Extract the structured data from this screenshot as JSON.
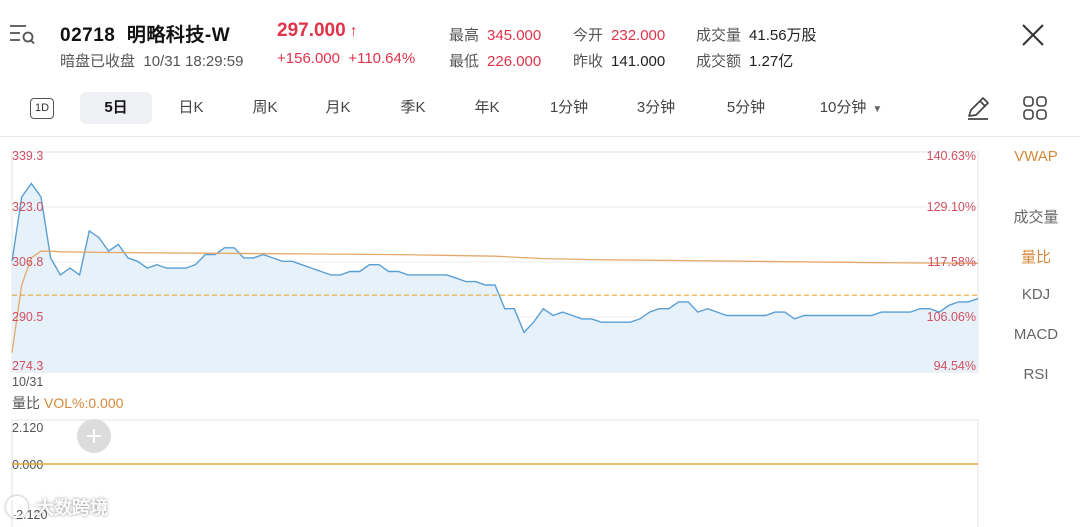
{
  "header": {
    "code": "02718",
    "name": "明略科技-W",
    "price": "297.000",
    "price_arrow": "↑",
    "status": "暗盘已收盘",
    "timestamp": "10/31 18:29:59",
    "change": "+156.000",
    "change_pct": "+110.64%",
    "stats": {
      "high_label": "最高",
      "high": "345.000",
      "low_label": "最低",
      "low": "226.000",
      "open_label": "今开",
      "open": "232.000",
      "prev_close_label": "昨收",
      "prev_close": "141.000",
      "volume_label": "成交量",
      "volume": "41.56万股",
      "turnover_label": "成交额",
      "turnover": "1.27亿"
    }
  },
  "tabs": {
    "one_day": "1D",
    "items": [
      "5日",
      "日K",
      "周K",
      "月K",
      "季K",
      "年K",
      "1分钟",
      "3分钟",
      "5分钟",
      "10分钟"
    ],
    "active": "5日"
  },
  "side_panel": {
    "items": [
      "VWAP",
      "成交量",
      "量比",
      "KDJ",
      "MACD",
      "RSI"
    ]
  },
  "colors": {
    "red": "#e0334a",
    "price_line": "#5a9fd4",
    "price_fill": "#e6f1fa",
    "avg_line": "#e5a86a",
    "ref_line": "#e7a73b",
    "vol_line": "#e7a73b"
  },
  "chart_data": {
    "type": "line",
    "date_label": "10/31",
    "y_left_ticks": [
      "339.3",
      "323.0",
      "306.8",
      "290.5",
      "274.3"
    ],
    "y_right_ticks": [
      "140.63%",
      "129.10%",
      "117.58%",
      "106.06%",
      "94.54%"
    ],
    "ylim": [
      274.3,
      339.3
    ],
    "reference_price": 297.0,
    "series": [
      {
        "name": "price",
        "x": [
          0,
          1,
          2,
          3,
          4,
          5,
          6,
          7,
          8,
          9,
          10,
          11,
          12,
          13,
          14,
          15,
          16,
          17,
          18,
          19,
          20,
          21,
          22,
          23,
          24,
          25,
          26,
          27,
          28,
          29,
          30,
          31,
          32,
          33,
          34,
          35,
          36,
          37,
          38,
          39,
          40,
          41,
          42,
          43,
          44,
          45,
          46,
          47,
          48,
          49,
          50,
          51,
          52,
          53,
          54,
          55,
          56,
          57,
          58,
          59,
          60,
          61,
          62,
          63,
          64,
          65,
          66,
          67,
          68,
          69,
          70,
          71,
          72,
          73,
          74,
          75,
          76,
          77,
          78,
          79,
          80,
          81,
          82,
          83,
          84,
          85,
          86,
          87,
          88,
          89,
          90,
          91,
          92,
          93,
          94,
          95,
          96,
          97,
          98,
          99,
          100
        ],
        "values": [
          307,
          326,
          330,
          326,
          308,
          303,
          305,
          303,
          316,
          314,
          310,
          312,
          308,
          307,
          305,
          306,
          305,
          305,
          305,
          306,
          309,
          309,
          311,
          311,
          308,
          308,
          309,
          308,
          307,
          307,
          306,
          305,
          304,
          303,
          303,
          304,
          304,
          306,
          306,
          304,
          304,
          303,
          303,
          303,
          303,
          303,
          302,
          301,
          301,
          300,
          300,
          293,
          293,
          286,
          289,
          293,
          291,
          292,
          291,
          290,
          290,
          289,
          289,
          289,
          289,
          290,
          292,
          293,
          293,
          295,
          295,
          292,
          293,
          292,
          291,
          291,
          291,
          291,
          291,
          292,
          292,
          290,
          291,
          291,
          291,
          291,
          291,
          291,
          291,
          291,
          292,
          292,
          292,
          292,
          293,
          293,
          292,
          294,
          295,
          295,
          296
        ]
      },
      {
        "name": "avg",
        "x": [
          0,
          1,
          2,
          3,
          4,
          5,
          10,
          20,
          30,
          40,
          50,
          55,
          60,
          70,
          80,
          90,
          100
        ],
        "values": [
          280,
          300,
          308,
          310,
          310,
          309.8,
          309.6,
          309.4,
          309.2,
          309.0,
          308.5,
          307.8,
          307.5,
          307.2,
          306.9,
          306.6,
          306.4
        ]
      }
    ],
    "volume_panel": {
      "label": "量比",
      "indicator": "VOL%:0.000",
      "y_ticks": [
        "2.120",
        "0.000",
        "-2.120"
      ],
      "values": [
        0,
        0
      ]
    }
  },
  "watermark": {
    "text": "大数跨境"
  }
}
